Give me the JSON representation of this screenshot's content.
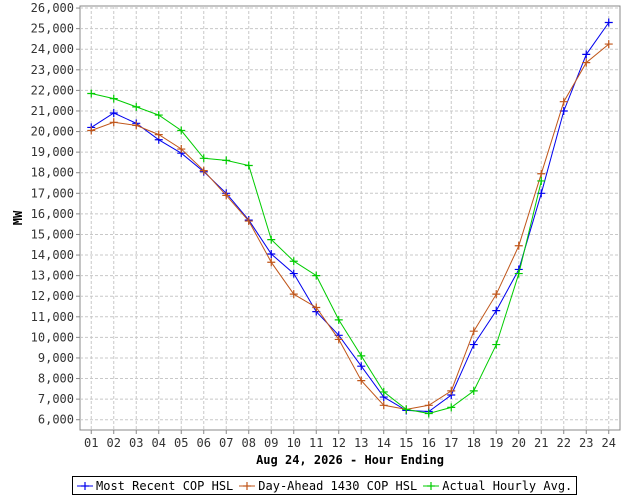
{
  "chart_data": {
    "type": "line",
    "xlabel": "Aug 24, 2026 - Hour Ending",
    "ylabel": "MW",
    "categories": [
      "01",
      "02",
      "03",
      "04",
      "05",
      "06",
      "07",
      "08",
      "09",
      "10",
      "11",
      "12",
      "13",
      "14",
      "15",
      "16",
      "17",
      "18",
      "19",
      "20",
      "21",
      "22",
      "23",
      "24"
    ],
    "ylim": [
      5500,
      26100
    ],
    "yticks": [
      6000,
      7000,
      8000,
      9000,
      10000,
      11000,
      12000,
      13000,
      14000,
      15000,
      16000,
      17000,
      18000,
      19000,
      20000,
      21000,
      22000,
      23000,
      24000,
      25000,
      26000
    ],
    "ytick_labels": [
      "6,000",
      "7,000",
      "8,000",
      "9,000",
      "10,000",
      "11,000",
      "12,000",
      "13,000",
      "14,000",
      "15,000",
      "16,000",
      "17,000",
      "18,000",
      "19,000",
      "20,000",
      "21,000",
      "22,000",
      "23,000",
      "24,000",
      "25,000",
      "26,000"
    ],
    "grid": true,
    "legend_position": "bottom",
    "series": [
      {
        "name": "Most Recent COP HSL",
        "color": "#0000ee",
        "values": [
          20200,
          20900,
          20400,
          19600,
          18950,
          18050,
          17000,
          15700,
          14050,
          13100,
          11250,
          10100,
          8600,
          7100,
          6450,
          6400,
          7200,
          9650,
          11300,
          13300,
          17000,
          21000,
          23750,
          25300
        ]
      },
      {
        "name": "Day-Ahead 1430 COP HSL",
        "color": "#c0561a",
        "values": [
          20050,
          20450,
          20300,
          19850,
          19150,
          18100,
          16900,
          15650,
          13650,
          12100,
          11450,
          9900,
          7900,
          6700,
          6500,
          6700,
          7400,
          10300,
          12100,
          14450,
          17950,
          21450,
          23350,
          24250
        ]
      },
      {
        "name": "Actual Hourly Avg.",
        "color": "#00cc00",
        "values": [
          21850,
          21600,
          21200,
          20800,
          20050,
          18700,
          18600,
          18350,
          14750,
          13700,
          13000,
          10850,
          9100,
          7350,
          6500,
          6300,
          6600,
          7400,
          9650,
          13100,
          17600,
          null,
          null,
          null
        ]
      }
    ]
  }
}
